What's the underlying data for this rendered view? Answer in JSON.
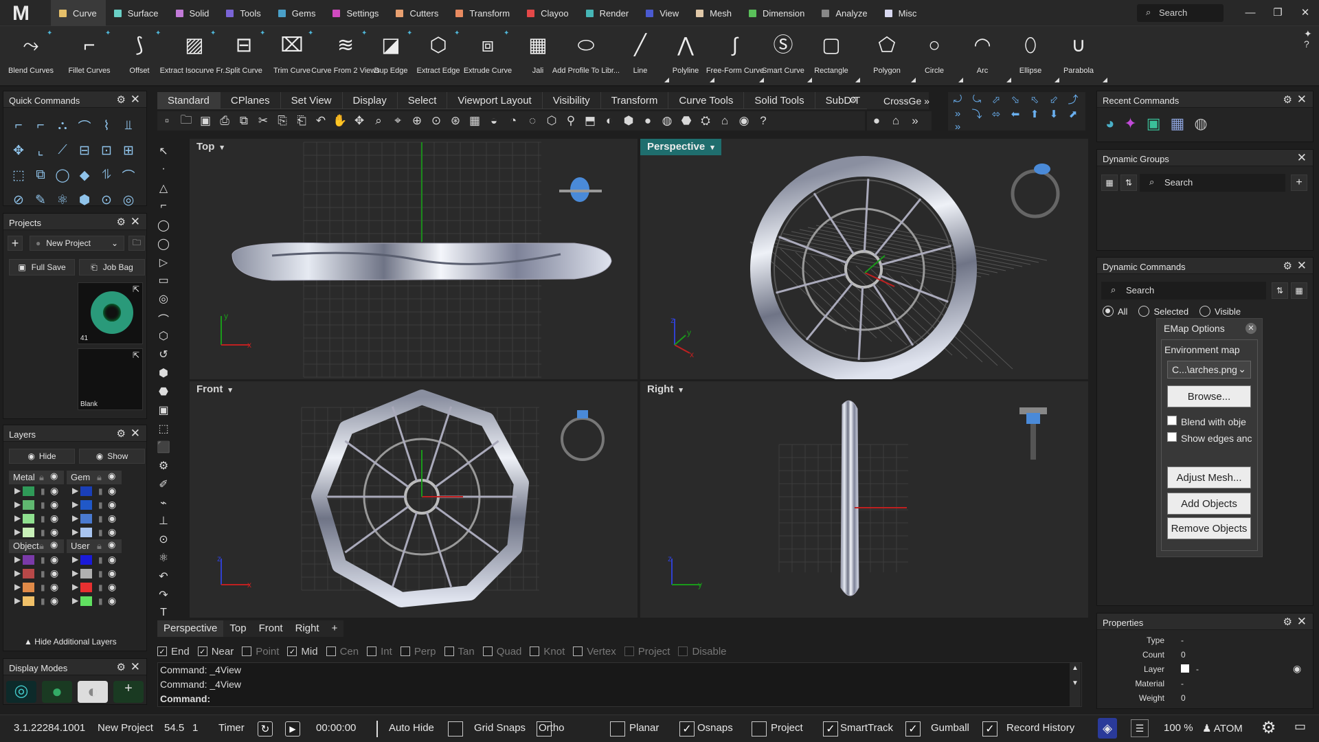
{
  "app": {
    "logo": "M"
  },
  "menu": {
    "tabs": [
      {
        "label": "Curve",
        "color": "#e6c06a"
      },
      {
        "label": "Surface",
        "color": "#6ad0c6"
      },
      {
        "label": "Solid",
        "color": "#c27ad8"
      },
      {
        "label": "Tools",
        "color": "#7a64d6"
      },
      {
        "label": "Gems",
        "color": "#4aa0c8"
      },
      {
        "label": "Settings",
        "color": "#d04ac0"
      },
      {
        "label": "Cutters",
        "color": "#e8a070"
      },
      {
        "label": "Transform",
        "color": "#e88a60"
      },
      {
        "label": "Clayoo",
        "color": "#e44848"
      },
      {
        "label": "Render",
        "color": "#46b6b6"
      },
      {
        "label": "View",
        "color": "#4a5ad0"
      },
      {
        "label": "Mesh",
        "color": "#e0c8a8"
      },
      {
        "label": "Dimension",
        "color": "#5ac05a"
      },
      {
        "label": "Analyze",
        "color": "#888888"
      },
      {
        "label": "Misc",
        "color": "#d8d8f0"
      }
    ],
    "search": "Search"
  },
  "ribbon": {
    "buttons": [
      {
        "label": "Blend Curves",
        "icon": "blend-curves-icon",
        "glyph": "⤳"
      },
      {
        "label": "Fillet Curves",
        "icon": "fillet-curves-icon",
        "glyph": "⌐"
      },
      {
        "label": "Offset",
        "icon": "offset-icon",
        "glyph": "⟆"
      },
      {
        "label": "Extract Isocurve Fr...",
        "icon": "extract-isocurve-icon",
        "glyph": "▨"
      },
      {
        "label": "Split Curve",
        "icon": "split-curve-icon",
        "glyph": "⊟"
      },
      {
        "label": "Trim Curve",
        "icon": "trim-curve-icon",
        "glyph": "⌧"
      },
      {
        "label": "Curve From 2 Views",
        "icon": "curve-from-2-views-icon",
        "glyph": "≋"
      },
      {
        "label": "Dup Edge",
        "icon": "dup-edge-icon",
        "glyph": "◪"
      },
      {
        "label": "Extract Edge",
        "icon": "extract-edge-icon",
        "glyph": "⬡"
      },
      {
        "label": "Extrude Curve",
        "icon": "extrude-curve-icon",
        "glyph": "⧈"
      },
      {
        "label": "Jali",
        "icon": "jali-icon",
        "glyph": "▦"
      },
      {
        "label": "Add Profile To Libr...",
        "icon": "add-profile-icon",
        "glyph": "⬭"
      },
      {
        "label": "Line",
        "icon": "line-icon",
        "glyph": "╱"
      },
      {
        "label": "Polyline",
        "icon": "polyline-icon",
        "glyph": "⋀"
      },
      {
        "label": "Free-Form Curve",
        "icon": "free-form-curve-icon",
        "glyph": "∫"
      },
      {
        "label": "Smart Curve",
        "icon": "smart-curve-icon",
        "glyph": "Ⓢ"
      },
      {
        "label": "Rectangle",
        "icon": "rectangle-icon",
        "glyph": "▢"
      },
      {
        "label": "Polygon",
        "icon": "polygon-icon",
        "glyph": "⬠"
      },
      {
        "label": "Circle",
        "icon": "circle-icon",
        "glyph": "○"
      },
      {
        "label": "Arc",
        "icon": "arc-icon",
        "glyph": "◠"
      },
      {
        "label": "Ellipse",
        "icon": "ellipse-icon",
        "glyph": "⬯"
      },
      {
        "label": "Parabola",
        "icon": "parabola-icon",
        "glyph": "∪"
      }
    ]
  },
  "quick": {
    "title": "Quick Commands"
  },
  "projects": {
    "title": "Projects",
    "dropdown": "New Project",
    "full_save": "Full Save",
    "job_bag": "Job Bag",
    "thumb1": "41",
    "thumb2": "Blank"
  },
  "layers": {
    "title": "Layers",
    "hide": "Hide",
    "show": "Show",
    "g1": "Metal",
    "g2": "Gem",
    "g3": "Object",
    "g4": "User",
    "more": "Hide Additional Layers",
    "metal_colors": [
      "#2f9a58",
      "#60b870",
      "#8fe08f",
      "#c8f0b8"
    ],
    "gem_colors": [
      "#1a3fb8",
      "#2058c8",
      "#4a7ad0",
      "#a8c4f0"
    ],
    "object_colors": [
      "#7a3aa8",
      "#b84848",
      "#e08a48",
      "#f0c068"
    ],
    "user_colors": [
      "#1a1ad8",
      "#b0b0b0",
      "#e83030",
      "#60e060"
    ]
  },
  "display_modes": {
    "title": "Display Modes"
  },
  "viewport_tabs": [
    "Standard",
    "CPlanes",
    "Set View",
    "Display",
    "Select",
    "Viewport Layout",
    "Visibility",
    "Transform",
    "Curve Tools",
    "Solid Tools",
    "SubD T"
  ],
  "viewport_tabs_right": "CrossGe",
  "viewports": {
    "top": "Top",
    "perspective": "Perspective",
    "front": "Front",
    "right": "Right"
  },
  "bottom_tabs": [
    "Perspective",
    "Top",
    "Front",
    "Right",
    "+"
  ],
  "osnaps": [
    {
      "label": "End",
      "on": true
    },
    {
      "label": "Near",
      "on": true
    },
    {
      "label": "Point",
      "on": false
    },
    {
      "label": "Mid",
      "on": true
    },
    {
      "label": "Cen",
      "on": false
    },
    {
      "label": "Int",
      "on": false
    },
    {
      "label": "Perp",
      "on": false
    },
    {
      "label": "Tan",
      "on": false
    },
    {
      "label": "Quad",
      "on": false
    },
    {
      "label": "Knot",
      "on": false
    },
    {
      "label": "Vertex",
      "on": false
    },
    {
      "label": "Project",
      "on": false,
      "disabled": true
    },
    {
      "label": "Disable",
      "on": false,
      "disabled": true
    }
  ],
  "command": {
    "lines": [
      "Command: _4View",
      "Command: _4View"
    ],
    "prompt": "Command:"
  },
  "status": {
    "version": "3.1.22284.1001",
    "project": "New Project",
    "v1": "54.5",
    "v2": "1",
    "timer": "Timer",
    "time": "00:00:00",
    "toggles": [
      {
        "label": "Auto Hide",
        "on": false
      },
      {
        "label": "Grid Snaps",
        "on": false
      },
      {
        "label": "Ortho",
        "on": false
      },
      {
        "label": "Planar",
        "on": false
      },
      {
        "label": "Osnaps",
        "on": true
      },
      {
        "label": "Project",
        "on": false
      },
      {
        "label": "SmartTrack",
        "on": true
      },
      {
        "label": "Gumball",
        "on": true
      },
      {
        "label": "Record History",
        "on": true
      }
    ],
    "zoom": "100 %",
    "user": "ATOM"
  },
  "right": {
    "recent": "Recent Commands",
    "groups": "Dynamic Groups",
    "groups_search": "Search",
    "dyn": "Dynamic Commands",
    "dyn_search": "Search",
    "radio_all": "All",
    "radio_selected": "Selected",
    "radio_visible": "Visible",
    "emap": {
      "title": "EMap Options",
      "env": "Environment map",
      "file": "C...\\arches.png",
      "browse": "Browse...",
      "blend": "Blend with obje",
      "edges": "Show edges anc",
      "adjust": "Adjust Mesh...",
      "add": "Add Objects",
      "remove": "Remove Objects"
    },
    "props": {
      "title": "Properties",
      "type_l": "Type",
      "type_v": "-",
      "count_l": "Count",
      "count_v": "0",
      "layer_l": "Layer",
      "layer_v": "-",
      "material_l": "Material",
      "material_v": "-",
      "weight_l": "Weight",
      "weight_v": "0"
    }
  }
}
